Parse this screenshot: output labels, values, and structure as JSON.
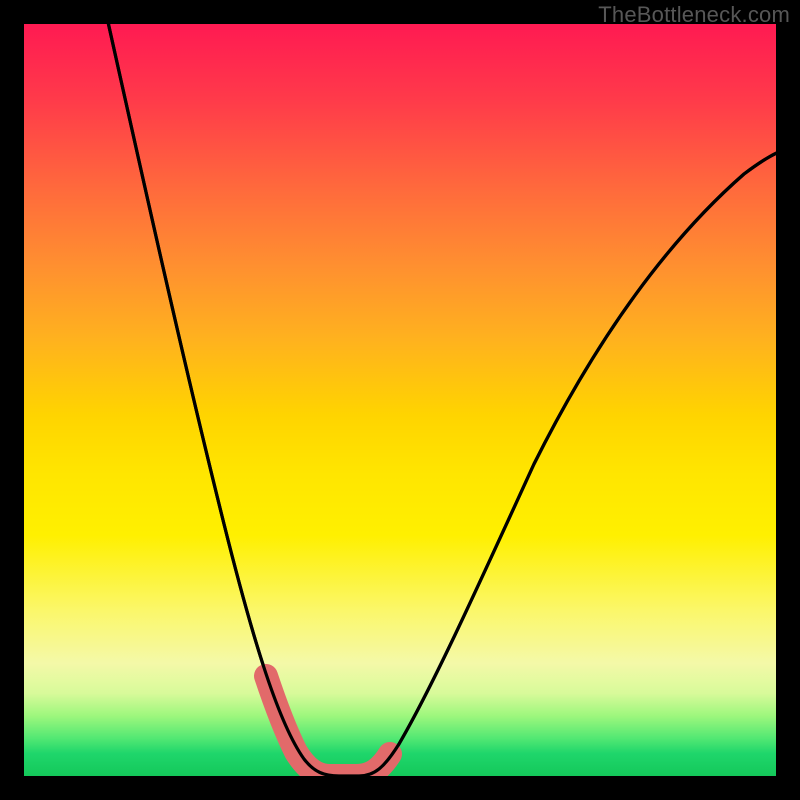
{
  "watermark": "TheBottleneck.com",
  "chart_data": {
    "type": "line",
    "title": "",
    "xlabel": "",
    "ylabel": "",
    "xlim": [
      0,
      100
    ],
    "ylim": [
      0,
      100
    ],
    "series": [
      {
        "name": "bottleneck-curve",
        "x": [
          10,
          12,
          14,
          16,
          18,
          20,
          22,
          24,
          26,
          28,
          30,
          32,
          34,
          36,
          38,
          40,
          42,
          45,
          50,
          55,
          60,
          65,
          70,
          75,
          80,
          85,
          90,
          95,
          100
        ],
        "y": [
          100,
          89,
          78,
          68,
          58,
          49,
          41,
          33,
          26,
          20,
          14,
          9,
          5,
          2,
          0.5,
          0,
          0.3,
          2,
          8,
          16,
          25,
          34,
          43,
          52,
          60,
          67,
          73,
          78,
          82
        ]
      }
    ],
    "highlight_segment": {
      "name": "optimal-range",
      "x": [
        30,
        32,
        34,
        36,
        38,
        40,
        42,
        44
      ],
      "y": [
        14,
        9,
        5,
        2,
        0.5,
        0,
        0.3,
        1
      ]
    },
    "gradient_stops": [
      {
        "pos": 0,
        "color": "#ff1a52"
      },
      {
        "pos": 50,
        "color": "#ffe600"
      },
      {
        "pos": 100,
        "color": "#14c85a"
      }
    ]
  }
}
